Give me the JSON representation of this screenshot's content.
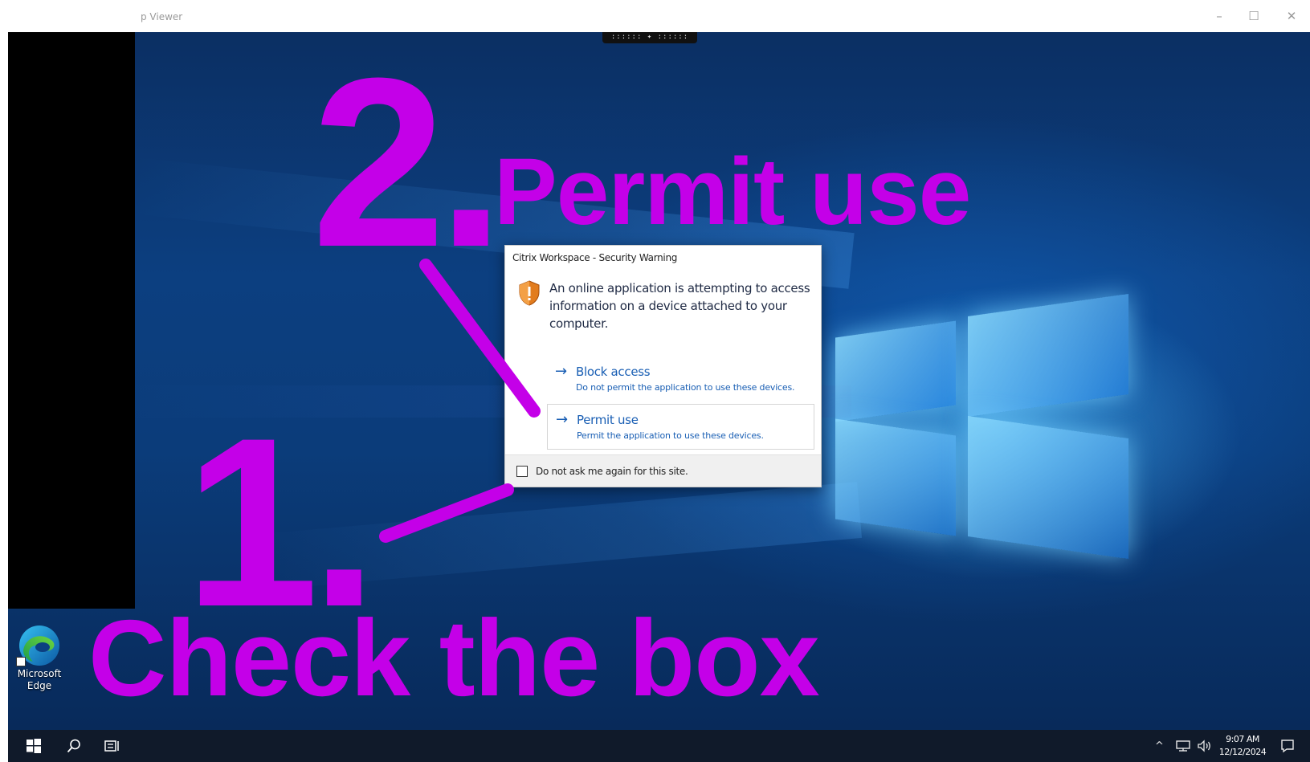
{
  "viewer": {
    "title": "p Viewer",
    "controls": {
      "minimize": "–",
      "maximize": "☐",
      "close": "✕"
    }
  },
  "connection_bar": {
    "label": ":::::: ✦ ::::::"
  },
  "dialog": {
    "title": "Citrix Workspace - Security Warning",
    "icon": "shield-warning-icon",
    "message": "An online application is attempting to access information on a device attached to your computer.",
    "options": [
      {
        "label": "Block access",
        "description": "Do not permit the application to use these devices."
      },
      {
        "label": "Permit use",
        "description": "Permit the application to use these devices."
      }
    ],
    "arrow": "→",
    "checkbox": {
      "label": "Do not ask me again for this site.",
      "checked": false
    }
  },
  "annotations": {
    "step2_number": "2.",
    "step2_text": "Permit use",
    "step1_number": "1.",
    "step1_text": "Check the box",
    "color": "#c400e8"
  },
  "desktop_icons": [
    {
      "label_line1": "Microsoft",
      "label_line2": "Edge",
      "icon": "edge-icon"
    }
  ],
  "taskbar": {
    "icons": [
      "windows-start-icon",
      "search-icon",
      "task-view-icon"
    ],
    "tray": {
      "chevron": "^",
      "time": "9:07 AM",
      "date": "12/12/2024"
    }
  },
  "colors": {
    "desktop_blue": "#0c3f80",
    "taskbar": "#101a2a",
    "link_blue": "#1a5fb4"
  }
}
